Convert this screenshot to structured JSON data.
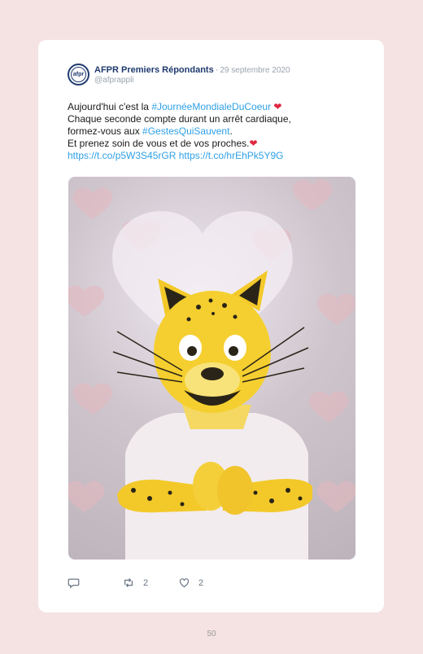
{
  "tweet": {
    "author_name": "AFPR Premiers Répondants",
    "separator": "·",
    "date": "29 septembre 2020",
    "handle": "@afprappli",
    "avatar_text": "afpr",
    "line1_prefix": "Aujourd'hui c'est la ",
    "line1_hashtag": "#JournéeMondialeDuCoeur",
    "line2": "Chaque seconde compte durant un arrêt cardiaque,",
    "line3_prefix": "formez-vous aux ",
    "line3_hashtag": "#GestesQuiSauvent",
    "line3_suffix": ".",
    "line4": "Et prenez soin de vous et de vos proches.",
    "link1": "https://t.co/p5W3S45rGR",
    "link2": "https://t.co/hrEhPk5Y9G",
    "heart_glyph": "❤",
    "retweet_count": "2",
    "like_count": "2"
  },
  "page_number": "50",
  "colors": {
    "background": "#f5e2e2",
    "card": "#ffffff",
    "link": "#2ea0e6",
    "heart": "#e0263f",
    "brand": "#1f3a6e"
  }
}
